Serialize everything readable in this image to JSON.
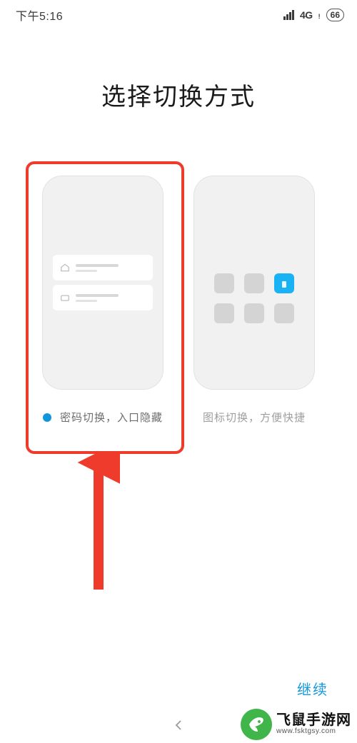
{
  "status_bar": {
    "time": "下午5:16",
    "network": "4G",
    "battery": "66"
  },
  "page": {
    "title": "选择切换方式",
    "continue_label": "继续"
  },
  "options": [
    {
      "id": "password-switch",
      "caption": "密码切换，入口隐藏",
      "selected": true
    },
    {
      "id": "icon-switch",
      "caption": "图标切换，方便快捷",
      "selected": false
    }
  ],
  "watermark": {
    "name_cn": "飞鼠手游网",
    "domain": "www.fsktgsy.com"
  },
  "annotation": {
    "highlight_target": "password-switch",
    "highlight_color": "#ef3b2c"
  }
}
